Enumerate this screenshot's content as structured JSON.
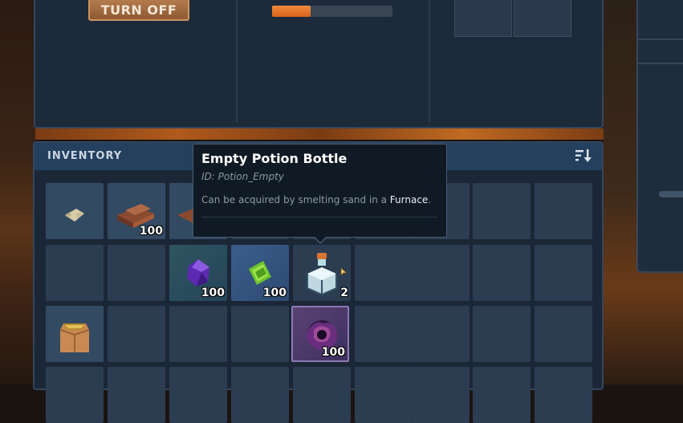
{
  "machine": {
    "turn_off_label": "TURN OFF",
    "progress": 0.32
  },
  "inventory": {
    "title": "INVENTORY",
    "slots": [
      {
        "row": 0,
        "col": 0,
        "item": "scroll-icon",
        "qty": ""
      },
      {
        "row": 0,
        "col": 1,
        "item": "wood-planks-icon",
        "qty": "100"
      },
      {
        "row": 0,
        "col": 2,
        "item": "wood-planks-icon",
        "qty": ""
      },
      {
        "row": 1,
        "col": 2,
        "item": "amethyst-crystal-icon",
        "qty": "100"
      },
      {
        "row": 1,
        "col": 3,
        "item": "green-gem-icon",
        "qty": "100"
      },
      {
        "row": 1,
        "col": 4,
        "item": "potion-bottle-icon",
        "qty": "2"
      },
      {
        "row": 2,
        "col": 0,
        "item": "sack-icon",
        "qty": ""
      },
      {
        "row": 2,
        "col": 4,
        "item": "void-bloom-icon",
        "qty": "100"
      }
    ]
  },
  "tooltip": {
    "name": "Empty Potion Bottle",
    "id_text": "ID: Potion_Empty",
    "desc_prefix": "Can be acquired by smelting sand in a ",
    "desc_highlight": "Furnace",
    "desc_suffix": "."
  },
  "colors": {
    "accent_orange": "#e8742a",
    "panel_bg": "#1b2737",
    "header_bg": "#24405e"
  }
}
